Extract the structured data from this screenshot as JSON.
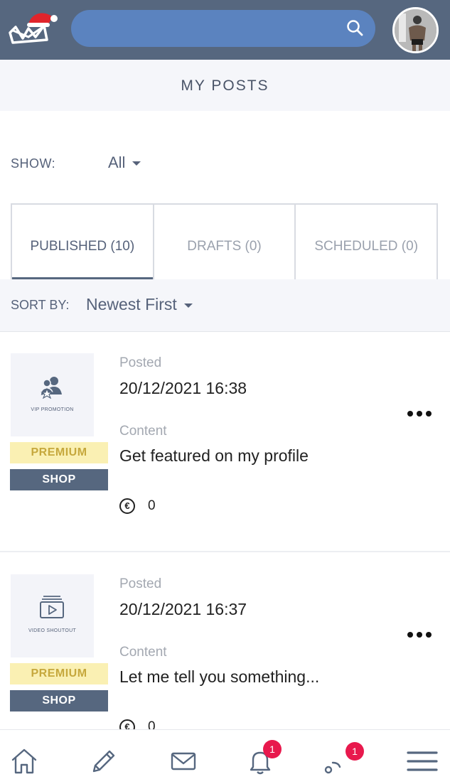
{
  "header": {
    "logo_icon": "brand-logo-with-santa-hat-icon",
    "search_icon": "search-icon",
    "search_value": "",
    "avatar_icon": "user-avatar"
  },
  "page": {
    "title": "MY POSTS"
  },
  "filter": {
    "show_label": "SHOW:",
    "show_value": "All"
  },
  "tabs": [
    {
      "label": "PUBLISHED (10)",
      "active": true
    },
    {
      "label": "DRAFTS (0)",
      "active": false
    },
    {
      "label": "SCHEDULED (0)",
      "active": false
    }
  ],
  "sort": {
    "label": "SORT BY:",
    "value": "Newest First"
  },
  "posts": [
    {
      "thumb_icon": "group-star-icon",
      "thumb_caption": "VIP PROMOTION",
      "premium_label": "PREMIUM",
      "shop_label": "SHOP",
      "posted_label": "Posted",
      "posted_value": "20/12/2021 16:38",
      "content_label": "Content",
      "content_value": "Get featured on my profile",
      "price_icon": "euro-coin-icon",
      "price_value": "0",
      "more_icon": "more-options-icon"
    },
    {
      "thumb_icon": "video-play-icon",
      "thumb_caption": "VIDEO SHOUTOUT",
      "premium_label": "PREMIUM",
      "shop_label": "SHOP",
      "posted_label": "Posted",
      "posted_value": "20/12/2021 16:37",
      "content_label": "Content",
      "content_value": "Let me tell you something...",
      "price_icon": "euro-coin-icon",
      "price_value": "0",
      "more_icon": "more-options-icon"
    }
  ],
  "bottom_nav": {
    "items": [
      {
        "icon": "home-icon"
      },
      {
        "icon": "edit-pencil-icon"
      },
      {
        "icon": "mail-icon"
      },
      {
        "icon": "bell-icon",
        "badge": "1"
      },
      {
        "icon": "feed-icon",
        "badge": "1"
      },
      {
        "icon": "menu-icon"
      }
    ]
  },
  "colors": {
    "header_bg": "#56677f",
    "search_bg": "#5b83bf",
    "premium_bg": "#faf0b3",
    "premium_text": "#c6a83d",
    "shop_bg": "#56677f",
    "badge_red": "#e8194d"
  }
}
